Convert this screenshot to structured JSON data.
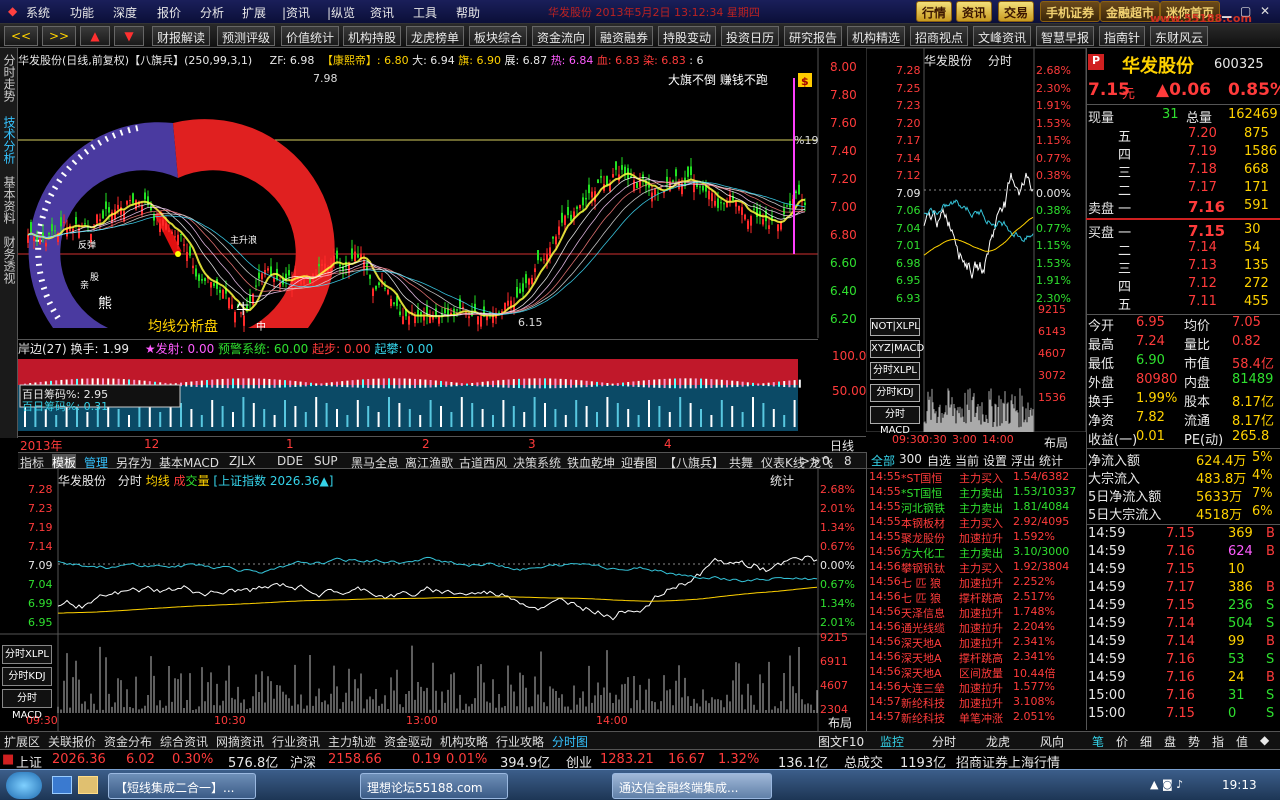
{
  "menu": {
    "items": [
      "系统",
      "功能",
      "深度",
      "报价",
      "分析",
      "扩展",
      "|资讯",
      "|纵览",
      "资讯",
      "工具",
      "帮助"
    ],
    "window_title": "　　　　　　　　华发股份 2013年5月2日 13:12:34 星期四",
    "buttons": [
      "行情",
      "资讯",
      "交易",
      "手机证券",
      "金融超市",
      "迷你首页"
    ],
    "watermark": "www.55188.com"
  },
  "toolbar": {
    "nav": [
      "<<",
      ">>",
      "▲",
      "▼"
    ],
    "items": [
      "财报解读",
      "预测评级",
      "价值统计",
      "机构持股",
      "龙虎榜单",
      "板块综合",
      "资金流向",
      "融资融券",
      "持股变动",
      "投资日历",
      "研究报告",
      "机构精选",
      "招商视点",
      "文峰资讯",
      "智慧早报",
      "指南针",
      "东财风云"
    ]
  },
  "left_tabs": [
    "分时走势",
    "技术分析",
    "基本资料",
    "财务透视"
  ],
  "kline": {
    "title": "华发股份(日线,前复权)【八旗兵】(250,99,3,1)",
    "zf": "ZF: 6.98",
    "kxd": "【康熙帝】: 6.80",
    "da": "大: 6.94",
    "qi": "旗: 6.90",
    "zhan": "展: 6.87",
    "re": "热: 6.84",
    "xue": "血: 6.83",
    "ran": "染: 6.83",
    "six": ": 6",
    "slogan": "大旗不倒 赚钱不跑",
    "high_label": "7.98",
    "low_label": "6.15",
    "pct_label": "%19",
    "gauge_title": "均线分析盘",
    "gauge_labels": [
      "主升浪",
      "反弹",
      "股",
      "亲",
      "熊",
      "牛",
      "中"
    ],
    "y_axis": [
      "8.00",
      "7.80",
      "7.60",
      "7.40",
      "7.20",
      "7.00",
      "6.80",
      "6.60",
      "6.40",
      "6.20"
    ]
  },
  "indicator": {
    "name": "岸边(27)",
    "hs": "换手: 1.99",
    "fs": "★发射: 0.00",
    "yj": "预警系统: 60.00",
    "qb": "起步: 0.00",
    "qp": "起攀: 0.00",
    "box1": "百日筹码%: 2.95",
    "box2": "百日筹码%: 0.31",
    "y_axis": [
      "100.0",
      "50.00"
    ]
  },
  "time_axis": {
    "labels": [
      "2013年",
      "12",
      "1",
      "2",
      "3",
      "4"
    ],
    "period": "日线"
  },
  "chip_tabs": [
    "指标",
    "模板",
    "管理",
    "另存为",
    "基本MACD",
    "ZJLX",
    "DDE",
    "SUP",
    "黑马全息",
    "离江渔歌",
    "古道西风",
    "决策系统",
    "铁血乾坤",
    "迎春图",
    "【八旗兵】",
    "共舞",
    "仪表K线",
    "龙飞"
  ],
  "chip_nav": [
    ">>",
    "0",
    "8"
  ],
  "mini": {
    "title": "华发股份",
    "stats": "分时",
    "prices": [
      "7.28",
      "7.25",
      "7.23",
      "7.20",
      "7.17",
      "7.14",
      "7.12",
      "7.09",
      "7.06",
      "7.04",
      "7.01",
      "6.98",
      "6.95",
      "6.93"
    ],
    "pcts": [
      "2.68%",
      "2.30%",
      "1.91%",
      "1.53%",
      "1.15%",
      "0.77%",
      "0.38%",
      "0.00%",
      "0.38%",
      "0.77%",
      "1.15%",
      "1.53%",
      "1.91%",
      "2.30%"
    ],
    "vols": [
      "9215",
      "6143",
      "4607",
      "3072",
      "1536"
    ],
    "times": [
      "09:30",
      "0:30",
      "3:00",
      "14:00"
    ],
    "buttons": [
      "NOT|XLPL",
      "XYZ|MACD",
      "分时XLPL",
      "分时KDJ",
      "分时MACD"
    ],
    "layout": "布局"
  },
  "intraday": {
    "title": "华发股份",
    "mode": "分时",
    "ma": "均线",
    "cheng": "成",
    "jiao": "交",
    "liang": "量",
    "index": "[上证指数 2026.36▲]",
    "stats": "统计",
    "prices": [
      "7.28",
      "7.23",
      "7.19",
      "7.14",
      "7.09",
      "7.04",
      "6.99",
      "6.95"
    ],
    "pcts": [
      "2.68%",
      "2.01%",
      "1.34%",
      "0.67%",
      "0.00%",
      "0.67%",
      "1.34%",
      "2.01%"
    ],
    "vols": [
      "9215",
      "6911",
      "4607",
      "2304"
    ],
    "times": [
      "09:30",
      "10:30",
      "13:00",
      "14:00"
    ],
    "buttons": [
      "分时XLPL",
      "分时KDJ",
      "分时MACD"
    ],
    "layout": "布局"
  },
  "news": {
    "tabs": [
      "全部",
      "300",
      "自选",
      "当前",
      "设置",
      "浮出",
      "统计"
    ],
    "items": [
      {
        "t": "14:55",
        "n": "*ST国恒",
        "a": "主力买入",
        "v": "1.54/6382"
      },
      {
        "t": "14:55",
        "n": "*ST国恒",
        "a": "主力卖出",
        "v": "1.53/10337"
      },
      {
        "t": "14:55",
        "n": "河北钢铁",
        "a": "主力卖出",
        "v": "1.81/4084"
      },
      {
        "t": "14:55",
        "n": "本钢板材",
        "a": "主力买入",
        "v": "2.92/4095"
      },
      {
        "t": "14:55",
        "n": "聚龙股份",
        "a": "加速拉升",
        "v": "1.592%"
      },
      {
        "t": "14:56",
        "n": "方大化工",
        "a": "主力卖出",
        "v": "3.10/3000"
      },
      {
        "t": "14:56",
        "n": "攀钢钒钛",
        "a": "主力买入",
        "v": "1.92/3804"
      },
      {
        "t": "14:56",
        "n": "七 匹 狼",
        "a": "加速拉升",
        "v": "2.252%"
      },
      {
        "t": "14:56",
        "n": "七 匹 狼",
        "a": "撑杆跳高",
        "v": "2.517%"
      },
      {
        "t": "14:56",
        "n": "天泽信息",
        "a": "加速拉升",
        "v": "1.748%"
      },
      {
        "t": "14:56",
        "n": "通光线缆",
        "a": "加速拉升",
        "v": "2.204%"
      },
      {
        "t": "14:56",
        "n": "深天地A",
        "a": "加速拉升",
        "v": "2.341%"
      },
      {
        "t": "14:56",
        "n": "深天地A",
        "a": "撑杆跳高",
        "v": "2.341%"
      },
      {
        "t": "14:56",
        "n": "深天地A",
        "a": "区间放量",
        "v": "10.44倍"
      },
      {
        "t": "14:56",
        "n": "大连三垒",
        "a": "加速拉升",
        "v": "1.577%"
      },
      {
        "t": "14:57",
        "n": "新纶科技",
        "a": "加速拉升",
        "v": "3.108%"
      },
      {
        "t": "14:57",
        "n": "新纶科技",
        "a": "单笔冲涨",
        "v": "2.051%"
      }
    ],
    "bottom": [
      "图文F10",
      "监控",
      "分时",
      "龙虎",
      "风向"
    ]
  },
  "quote": {
    "name": "华发股份",
    "code": "600325",
    "p": "P",
    "price": "7.15",
    "unit": "元",
    "change": "▲0.06",
    "pct": "0.85%",
    "xianliang_label": "现量",
    "xianliang": "31",
    "zongliang_label": "总量",
    "zongliang": "162469",
    "sell": [
      {
        "l": "五",
        "p": "7.20",
        "v": "875"
      },
      {
        "l": "四",
        "p": "7.19",
        "v": "1586"
      },
      {
        "l": "三",
        "p": "7.18",
        "v": "668"
      },
      {
        "l": "二",
        "p": "7.17",
        "v": "171"
      },
      {
        "l": "卖盘 一",
        "p": "7.16",
        "v": "591"
      }
    ],
    "buy": [
      {
        "l": "买盘 一",
        "p": "7.15",
        "v": "30"
      },
      {
        "l": "二",
        "p": "7.14",
        "v": "54"
      },
      {
        "l": "三",
        "p": "7.13",
        "v": "135"
      },
      {
        "l": "四",
        "p": "7.12",
        "v": "272"
      },
      {
        "l": "五",
        "p": "7.11",
        "v": "455"
      }
    ],
    "stats": [
      {
        "k1": "今开",
        "v1": "6.95",
        "k2": "均价",
        "v2": "7.05"
      },
      {
        "k1": "最高",
        "v1": "7.24",
        "k2": "量比",
        "v2": "0.82"
      },
      {
        "k1": "最低",
        "v1": "6.90",
        "k2": "市值",
        "v2": "58.4亿"
      },
      {
        "k1": "外盘",
        "v1": "80980",
        "k2": "内盘",
        "v2": "81489"
      },
      {
        "k1": "换手",
        "v1": "1.99%",
        "k2": "股本",
        "v2": "8.17亿"
      },
      {
        "k1": "净资",
        "v1": "7.82",
        "k2": "流通",
        "v2": "8.17亿"
      },
      {
        "k1": "收益(一)",
        "v1": "0.01",
        "k2": "PE(动)",
        "v2": "265.8"
      }
    ],
    "flows": [
      {
        "k": "净流入额",
        "v": "624.4万",
        "p": "5%"
      },
      {
        "k": "大宗流入",
        "v": "483.8万",
        "p": "4%"
      },
      {
        "k": "5日净流入额",
        "v": "5633万",
        "p": "7%"
      },
      {
        "k": "5日大宗流入",
        "v": "4518万",
        "p": "6%"
      }
    ],
    "ticks": [
      {
        "t": "14:59",
        "p": "7.15",
        "v": "369",
        "s": "B"
      },
      {
        "t": "14:59",
        "p": "7.16",
        "v": "624",
        "s": "B"
      },
      {
        "t": "14:59",
        "p": "7.15",
        "v": "10",
        "s": ""
      },
      {
        "t": "14:59",
        "p": "7.17",
        "v": "386",
        "s": "B"
      },
      {
        "t": "14:59",
        "p": "7.15",
        "v": "236",
        "s": "S"
      },
      {
        "t": "14:59",
        "p": "7.14",
        "v": "504",
        "s": "S"
      },
      {
        "t": "14:59",
        "p": "7.14",
        "v": "99",
        "s": "B"
      },
      {
        "t": "14:59",
        "p": "7.16",
        "v": "53",
        "s": "S"
      },
      {
        "t": "14:59",
        "p": "7.16",
        "v": "24",
        "s": "B"
      },
      {
        "t": "15:00",
        "p": "7.16",
        "v": "31",
        "s": "S"
      },
      {
        "t": "15:00",
        "p": "7.15",
        "v": "0",
        "s": "S"
      }
    ],
    "tabs": [
      "笔",
      "价",
      "细",
      "盘",
      "势",
      "指",
      "值",
      "◆"
    ]
  },
  "bottom_tabs": [
    "扩展区",
    "关联报价",
    "资金分布",
    "综合资讯",
    "网摘资讯",
    "行业资讯",
    "主力轨迹",
    "资金驱动",
    "机构攻略",
    "行业攻略",
    "分时图"
  ],
  "status": {
    "sh": "上证",
    "sh_v": "2026.36",
    "sh_c": "6.02",
    "sh_p": "0.30%",
    "sh_a": "576.8亿",
    "sz": "沪深",
    "sz_v": "2158.66",
    "sz_c": "0.19",
    "sz_p": "0.01%",
    "sz_a": "394.9亿",
    "cy": "创业",
    "cy_v": "1283.21",
    "cy_c": "16.67",
    "cy_p": "1.32%",
    "cy_a": "136.1亿",
    "total": "总成交",
    "total_v": "1193亿",
    "broker": "招商证券上海行情"
  },
  "taskbar": {
    "tasks": [
      "【短线集成二合一】...",
      "理想论坛55188.com",
      "通达信金融终端集成..."
    ],
    "clock": "19:13"
  }
}
